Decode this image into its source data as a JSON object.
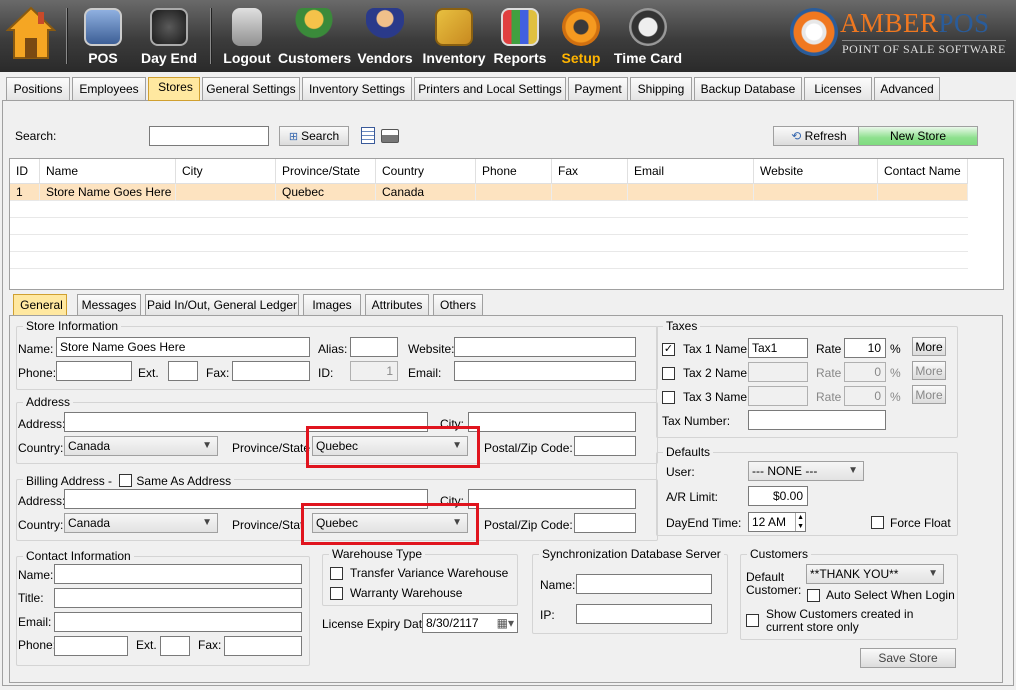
{
  "toolbar": {
    "items": [
      {
        "label": "POS",
        "icon": "pos-terminal-icon"
      },
      {
        "label": "Day End",
        "icon": "safe-dollar-icon"
      },
      {
        "label": "Logout",
        "icon": "padlock-icon"
      },
      {
        "label": "Customers",
        "icon": "customers-group-icon"
      },
      {
        "label": "Vendors",
        "icon": "vendor-person-icon"
      },
      {
        "label": "Inventory",
        "icon": "inventory-boxes-icon"
      },
      {
        "label": "Reports",
        "icon": "reports-chart-icon"
      },
      {
        "label": "Setup",
        "icon": "gear-icon"
      },
      {
        "label": "Time Card",
        "icon": "clock-icon"
      }
    ],
    "home_icon": "home-icon",
    "active": "Setup"
  },
  "logo": {
    "part1": "AMBER",
    "part2": "POS",
    "tagline": "POINT OF SALE SOFTWARE"
  },
  "main_tabs": [
    "Positions",
    "Employees",
    "Stores",
    "General Settings",
    "Inventory Settings",
    "Printers and Local Settings",
    "Payment",
    "Shipping",
    "Backup Database",
    "Licenses",
    "Advanced"
  ],
  "search": {
    "label": "Search:",
    "value": "",
    "button": "Search"
  },
  "buttons": {
    "refresh": "Refresh",
    "new_store": "New Store",
    "save_store": "Save Store"
  },
  "grid": {
    "columns": [
      "ID",
      "Name",
      "City",
      "Province/State",
      "Country",
      "Phone",
      "Fax",
      "Email",
      "Website",
      "Contact Name"
    ],
    "rows": [
      [
        "1",
        "Store Name Goes Here",
        "",
        "Quebec",
        "Canada",
        "",
        "",
        "",
        "",
        ""
      ]
    ]
  },
  "sub_tabs": [
    "General",
    "Messages",
    "Paid In/Out, General Ledger",
    "Images",
    "Attributes",
    "Others"
  ],
  "store_info": {
    "title": "Store Information",
    "name_label": "Name:",
    "name": "Store Name Goes Here",
    "alias_label": "Alias:",
    "alias": "",
    "website_label": "Website:",
    "website": "",
    "phone_label": "Phone:",
    "phone": "",
    "ext_label": "Ext.",
    "ext": "",
    "fax_label": "Fax:",
    "fax": "",
    "id_label": "ID:",
    "id": "1",
    "email_label": "Email:",
    "email": ""
  },
  "address": {
    "title": "Address",
    "address_label": "Address:",
    "address": "",
    "city_label": "City:",
    "city": "",
    "country_label": "Country:",
    "country": "Canada",
    "province_label": "Province/State",
    "province": "Quebec",
    "postal_label": "Postal/Zip Code:",
    "postal": ""
  },
  "billing": {
    "title": "Billing Address -",
    "same_label": "Same As Address",
    "same_checked": false,
    "address_label": "Address:",
    "address": "",
    "city_label": "City:",
    "city": "",
    "country_label": "Country:",
    "country": "Canada",
    "province_label": "Province/Stat",
    "province": "Quebec",
    "postal_label": "Postal/Zip Code:",
    "postal": ""
  },
  "taxes": {
    "title": "Taxes",
    "rows": [
      {
        "label": "Tax 1 Name",
        "name": "Tax1",
        "rate_label": "Rate",
        "rate": "10",
        "pct": "%",
        "more": "More",
        "checked": true
      },
      {
        "label": "Tax 2 Name",
        "name": "",
        "rate_label": "Rate",
        "rate": "0",
        "pct": "%",
        "more": "More",
        "checked": false
      },
      {
        "label": "Tax 3 Name",
        "name": "",
        "rate_label": "Rate",
        "rate": "0",
        "pct": "%",
        "more": "More",
        "checked": false
      }
    ],
    "tax_number_label": "Tax Number:",
    "tax_number": ""
  },
  "defaults": {
    "title": "Defaults",
    "user_label": "User:",
    "user": "--- NONE ---",
    "ar_label": "A/R Limit:",
    "ar_limit": "$0.00",
    "dayend_label": "DayEnd Time:",
    "dayend": "12 AM",
    "force_float_label": "Force Float",
    "force_float": false
  },
  "contact": {
    "title": "Contact Information",
    "name_label": "Name:",
    "name": "",
    "title_label": "Title:",
    "title_value": "",
    "email_label": "Email:",
    "email": "",
    "phone_label": "Phone:",
    "phone": "",
    "ext_label": "Ext.",
    "ext": "",
    "fax_label": "Fax:",
    "fax": ""
  },
  "warehouse": {
    "title": "Warehouse Type",
    "transfer_label": "Transfer Variance Warehouse",
    "warranty_label": "Warranty Warehouse",
    "license_label": "License Expiry Date:",
    "license_date": "8/30/2117"
  },
  "sync": {
    "title": "Synchronization Database Server",
    "name_label": "Name:",
    "name": "",
    "ip_label": "IP:",
    "ip": ""
  },
  "customers": {
    "title": "Customers",
    "default_label_1": "Default",
    "default_label_2": "Customer:",
    "default_value": "**THANK YOU**",
    "auto_select_label": "Auto Select When Login",
    "show_label_1": "Show Customers created in",
    "show_label_2": "current store only"
  },
  "colors": {
    "selected_tab": "#ffe8a0",
    "selected_row": "#fde3c0",
    "highlight_box": "#e0141e",
    "new_store_btn": "#7fdc7f"
  }
}
